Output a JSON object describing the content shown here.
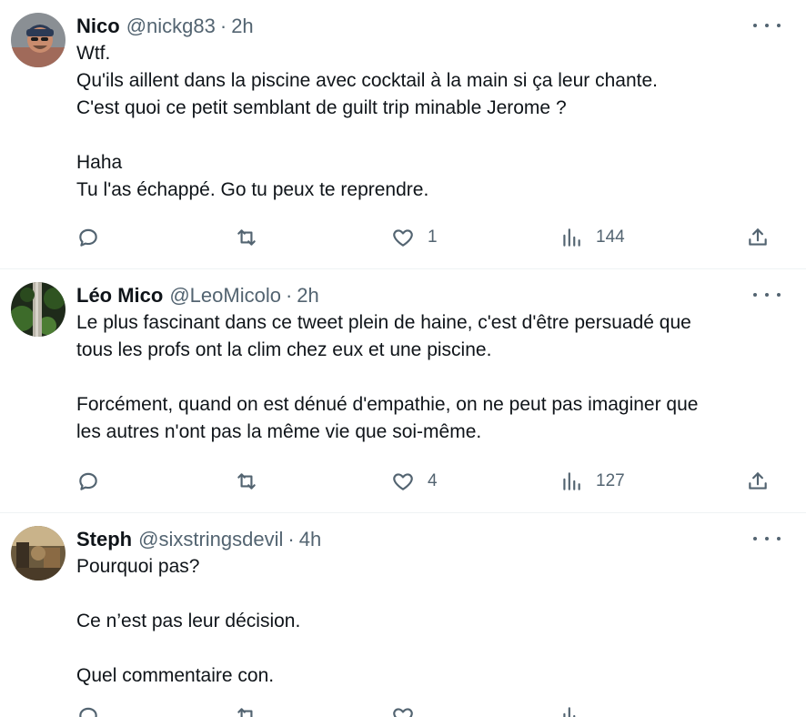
{
  "tweets": [
    {
      "name": "Nico",
      "handle": "@nickg83",
      "separator": "·",
      "time": "2h",
      "lines": [
        "Wtf.",
        "Qu'ils aillent dans la piscine avec cocktail à la main si ça leur chante.",
        "C'est quoi ce petit semblant de guilt trip minable Jerome ?",
        "",
        "Haha",
        "Tu l'as échappé. Go tu peux te reprendre."
      ],
      "replies": "",
      "retweets": "",
      "likes": "1",
      "views": "144",
      "avatar_colors": {
        "bg": "#8a8f94",
        "skin": "#c98c6e",
        "hat": "#2b3a55"
      }
    },
    {
      "name": "Léo Mico",
      "handle": "@LeoMicolo",
      "separator": "·",
      "time": "2h",
      "lines": [
        "Le plus fascinant dans ce tweet plein de haine, c'est d'être persuadé que",
        "tous les profs ont la clim chez eux et une piscine.",
        "",
        "Forcément, quand on est dénué d'empathie, on ne peut pas imaginer que",
        "les autres n'ont pas la même vie que soi-même."
      ],
      "replies": "",
      "retweets": "",
      "likes": "4",
      "views": "127",
      "avatar_colors": {
        "bg": "#1e2a1a",
        "leaf": "#3d6b2a",
        "trunk": "#b9b4a8"
      }
    },
    {
      "name": "Steph",
      "handle": "@sixstringsdevil",
      "separator": "·",
      "time": "4h",
      "lines": [
        "Pourquoi pas?",
        "",
        "Ce n’est pas leur décision.",
        "",
        "Quel commentaire con."
      ],
      "replies": "",
      "retweets": "",
      "likes": "",
      "views": "",
      "avatar_colors": {
        "bg": "#6b5a3e",
        "light": "#c9b38a",
        "dark": "#3a2f22"
      }
    }
  ],
  "icons": {
    "reply": "reply-icon",
    "retweet": "retweet-icon",
    "like": "heart-icon",
    "views": "views-icon",
    "share": "share-icon",
    "more": "more-icon"
  }
}
